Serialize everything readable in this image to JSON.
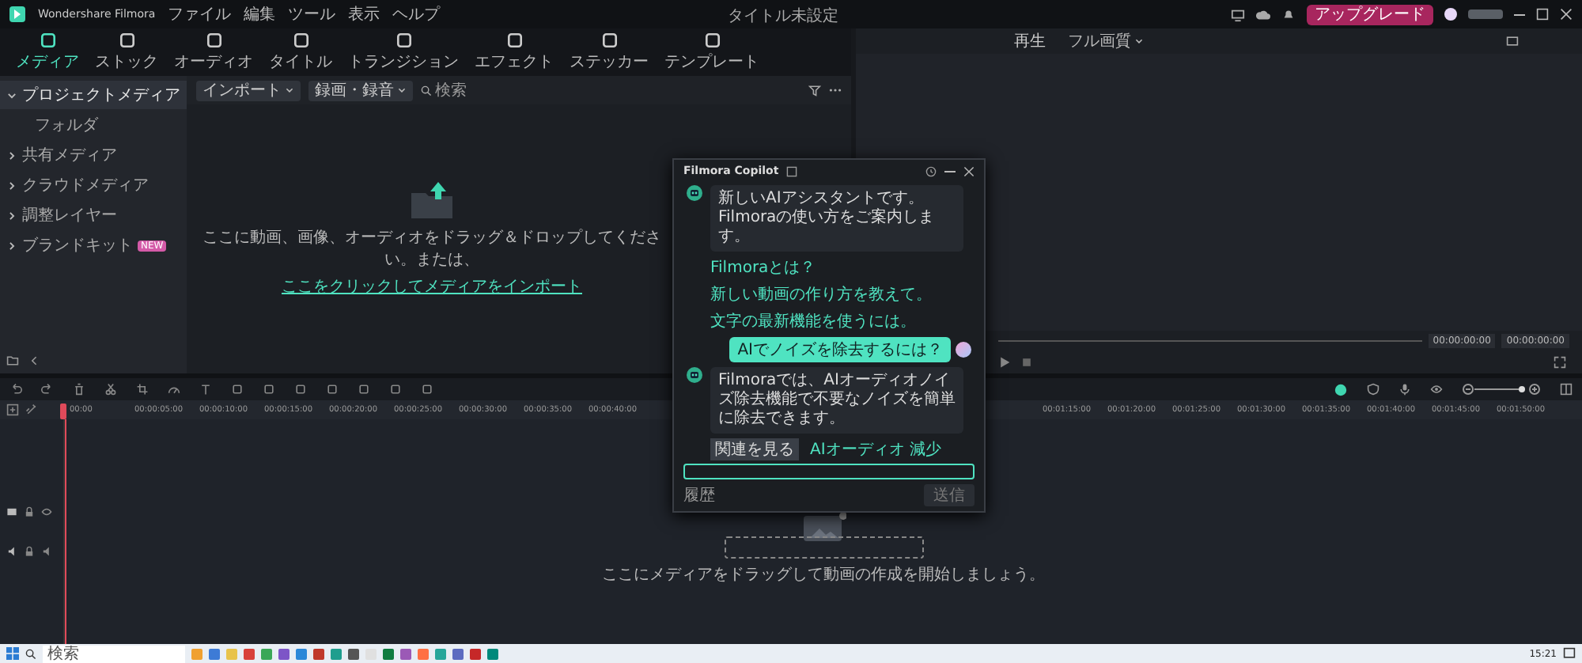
{
  "title_bar": {
    "app_name": "Wondershare Filmora",
    "menu": [
      "ファイル",
      "編集",
      "ツール",
      "表示",
      "ヘルプ"
    ],
    "project_title": "タイトル未設定",
    "upgrade_button": "アップグレード"
  },
  "media_tabs": [
    {
      "label": "メディア",
      "selected": true
    },
    {
      "label": "ストック",
      "selected": false
    },
    {
      "label": "オーディオ",
      "selected": false
    },
    {
      "label": "タイトル",
      "selected": false
    },
    {
      "label": "トランジション",
      "selected": false
    },
    {
      "label": "エフェクト",
      "selected": false
    },
    {
      "label": "ステッカー",
      "selected": false
    },
    {
      "label": "テンプレート",
      "selected": false
    }
  ],
  "sidebar": {
    "items": [
      {
        "label": "プロジェクトメディア",
        "selected": true,
        "expanded": true,
        "children": [
          {
            "label": "フォルダ",
            "selected": false
          }
        ]
      },
      {
        "label": "共有メディア",
        "selected": false,
        "expanded": false
      },
      {
        "label": "クラウドメディア",
        "selected": false,
        "expanded": false
      },
      {
        "label": "調整レイヤー",
        "selected": false,
        "expanded": false
      },
      {
        "label": "ブランドキット",
        "selected": false,
        "expanded": false,
        "badge": "NEW"
      }
    ]
  },
  "media_toolbar": {
    "import_button": "インポート",
    "record_button": "録画・録音",
    "search_placeholder": "検索"
  },
  "media_empty": {
    "message": "ここに動画、画像、オーディオをドラッグ＆ドロップしてください。または、",
    "link": "ここをクリックしてメディアをインポート"
  },
  "preview": {
    "tab": "再生",
    "quality": "フル画質",
    "timecode": "00:00:00:00",
    "duration": "00:00:00:00"
  },
  "copilot": {
    "title": "Filmora Copilot",
    "messages": [
      {
        "kind": "assistant",
        "text": "新しいAIアシスタントです。Filmoraの使い方をご案内します。"
      },
      {
        "kind": "suggestion",
        "text": "Filmoraとは？"
      },
      {
        "kind": "suggestion",
        "text": "新しい動画の作り方を教えて。"
      },
      {
        "kind": "suggestion",
        "text": "文字の最新機能を使うには。"
      },
      {
        "kind": "user",
        "text": "AIでノイズを除去するには？"
      },
      {
        "kind": "assistant",
        "text": "Filmoraでは、AIオーディオノイズ除去機能で不要なノイズを簡単に除去できます。"
      }
    ],
    "actions": [
      "関連を見る",
      "AIオーディオ 減少"
    ],
    "footer_text": "履歴",
    "send_button": {
      "label": "送信",
      "disabled": true
    }
  },
  "timeline": {
    "ruler_left": [
      "00:00",
      "00:00:05:00",
      "00:00:10:00",
      "00:00:15:00",
      "00:00:20:00",
      "00:00:25:00",
      "00:00:30:00",
      "00:00:35:00",
      "00:00:40:00"
    ],
    "ruler_right": [
      "00:01:15:00",
      "00:01:20:00",
      "00:01:25:00",
      "00:01:30:00",
      "00:01:35:00",
      "00:01:40:00",
      "00:01:45:00",
      "00:01:50:00"
    ],
    "drop_message": "ここにメディアをドラッグして動画の作成を開始しましょう。"
  },
  "taskbar": {
    "search_placeholder": "検索",
    "time": "15:21"
  }
}
